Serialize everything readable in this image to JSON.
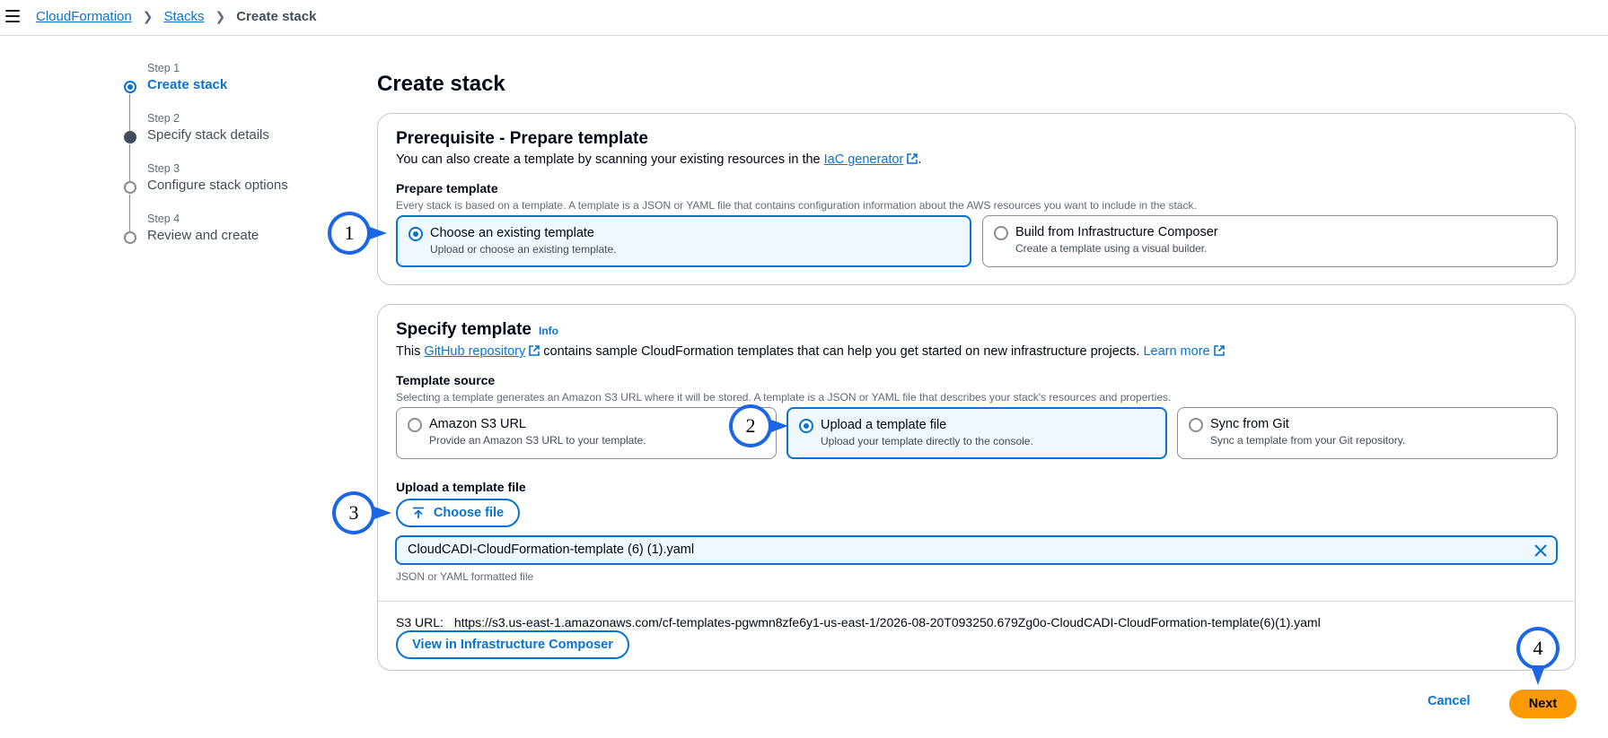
{
  "breadcrumb": {
    "items": [
      "CloudFormation",
      "Stacks"
    ],
    "current": "Create stack"
  },
  "stepper": [
    {
      "num": "Step 1",
      "title": "Create stack",
      "state": "active"
    },
    {
      "num": "Step 2",
      "title": "Specify stack details",
      "state": "done"
    },
    {
      "num": "Step 3",
      "title": "Configure stack options",
      "state": "pending"
    },
    {
      "num": "Step 4",
      "title": "Review and create",
      "state": "pending"
    }
  ],
  "page_title": "Create stack",
  "prereq": {
    "title": "Prerequisite - Prepare template",
    "desc_prefix": "You can also create a template by scanning your existing resources in the ",
    "desc_link": "IaC generator",
    "desc_suffix": ".",
    "field_label": "Prepare template",
    "field_desc": "Every stack is based on a template. A template is a JSON or YAML file that contains configuration information about the AWS resources you want to include in the stack.",
    "options": [
      {
        "title": "Choose an existing template",
        "desc": "Upload or choose an existing template.",
        "selected": true
      },
      {
        "title": "Build from Infrastructure Composer",
        "desc": "Create a template using a visual builder.",
        "selected": false
      }
    ]
  },
  "specify": {
    "title": "Specify template",
    "info": "Info",
    "desc_prefix": "This ",
    "desc_link": "GitHub repository",
    "desc_middle": " contains sample CloudFormation templates that can help you get started on new infrastructure projects. ",
    "desc_link2": "Learn more",
    "source_label": "Template source",
    "source_desc": "Selecting a template generates an Amazon S3 URL where it will be stored. A template is a JSON or YAML file that describes your stack's resources and properties.",
    "options": [
      {
        "title": "Amazon S3 URL",
        "desc": "Provide an Amazon S3 URL to your template.",
        "selected": false
      },
      {
        "title": "Upload a template file",
        "desc": "Upload your template directly to the console.",
        "selected": true
      },
      {
        "title": "Sync from Git",
        "desc": "Sync a template from your Git repository.",
        "selected": false
      }
    ],
    "upload_label": "Upload a template file",
    "choose_file": "Choose file",
    "file_name": "CloudCADI-CloudFormation-template (6) (1).yaml",
    "file_hint": "JSON or YAML formatted file",
    "s3_label": "S3 URL:",
    "s3_url": "https://s3.us-east-1.amazonaws.com/cf-templates-pgwmn8zfe6y1-us-east-1/2026-08-20T093250.679Zg0o-CloudCADI-CloudFormation-template(6)(1).yaml",
    "view_composer": "View in Infrastructure Composer"
  },
  "footer": {
    "cancel": "Cancel",
    "next": "Next"
  },
  "callouts": [
    "1",
    "2",
    "3",
    "4"
  ],
  "colors": {
    "accent": "#0972d3",
    "primary_button": "#ff9900",
    "callout_ring": "#1a66e6"
  }
}
